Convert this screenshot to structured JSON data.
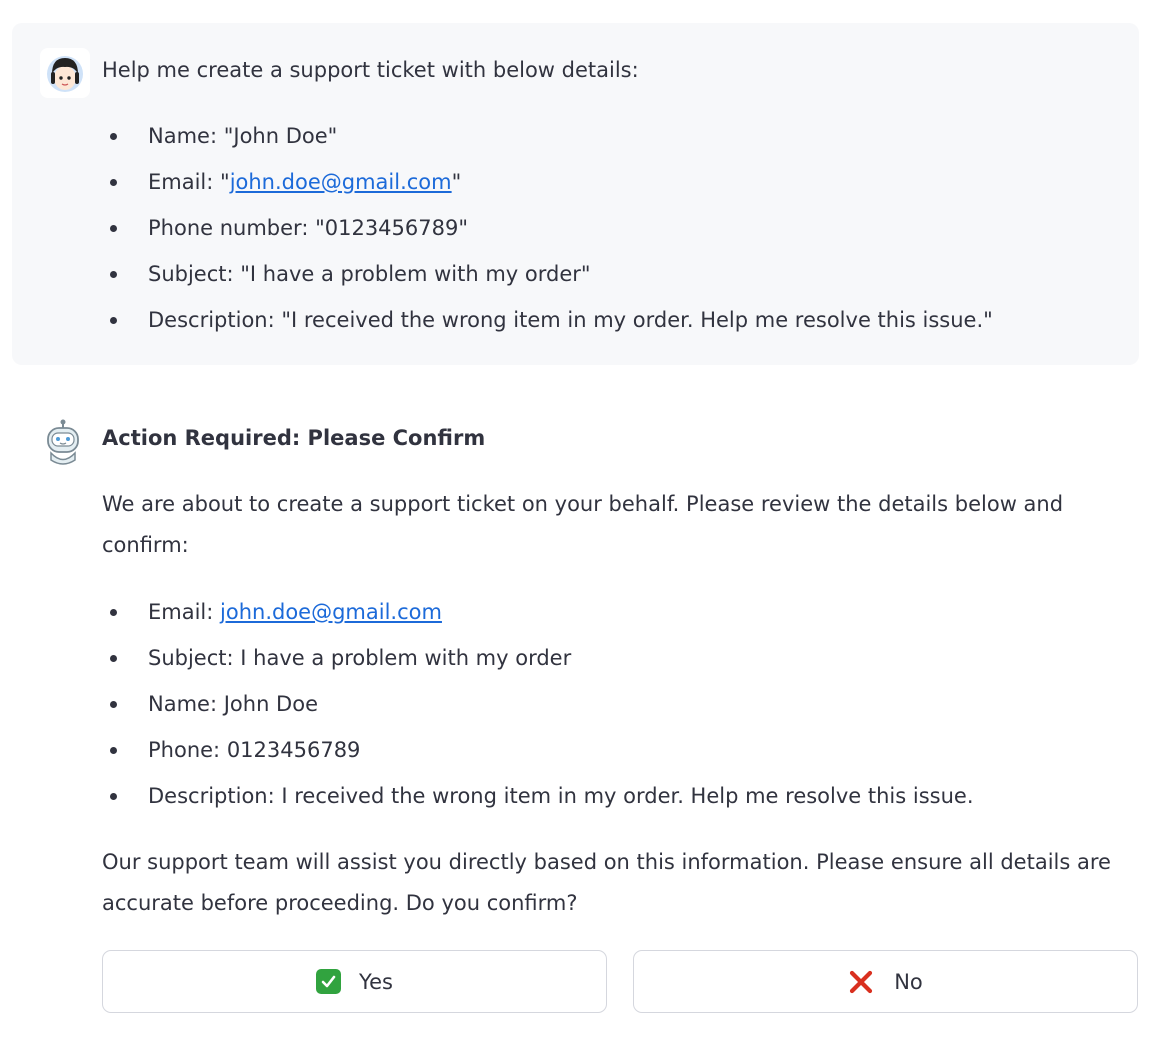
{
  "user_message": {
    "intro": "Help me create a support ticket with below details:",
    "items": [
      {
        "label": "Name: ",
        "value": "\"John Doe\""
      },
      {
        "label": "Email: \"",
        "link": "john.doe@gmail.com",
        "suffix": "\""
      },
      {
        "label": "Phone number: ",
        "value": "\"0123456789\""
      },
      {
        "label": "Subject: ",
        "value": "\"I have a problem with my order\""
      },
      {
        "label": "Description: ",
        "value": "\"I received the wrong item in my order. Help me resolve this issue.\""
      }
    ]
  },
  "bot_message": {
    "heading": "Action Required: Please Confirm",
    "intro": "We are about to create a support ticket on your behalf. Please review the details below and confirm:",
    "items": [
      {
        "label": "Email: ",
        "link": "john.doe@gmail.com"
      },
      {
        "label": "Subject: ",
        "value": "I have a problem with my order"
      },
      {
        "label": "Name: ",
        "value": "John Doe"
      },
      {
        "label": "Phone: ",
        "value": "0123456789"
      },
      {
        "label": "Description: ",
        "value": "I received the wrong item in my order. Help me resolve this issue."
      }
    ],
    "closing": "Our support team will assist you directly based on this information. Please ensure all details are accurate before proceeding. Do you confirm?",
    "buttons": {
      "yes_label": "Yes",
      "no_label": "No"
    }
  },
  "colors": {
    "link": "#1c6ad9",
    "user_bg": "#f7f8fa",
    "text": "#31333f",
    "check_green": "#31a33f",
    "cross_red": "#d9301f"
  },
  "icons": {
    "user_avatar": "user-avatar-icon",
    "bot_avatar": "robot-avatar-icon",
    "yes": "check-mark-icon",
    "no": "cross-mark-icon"
  }
}
